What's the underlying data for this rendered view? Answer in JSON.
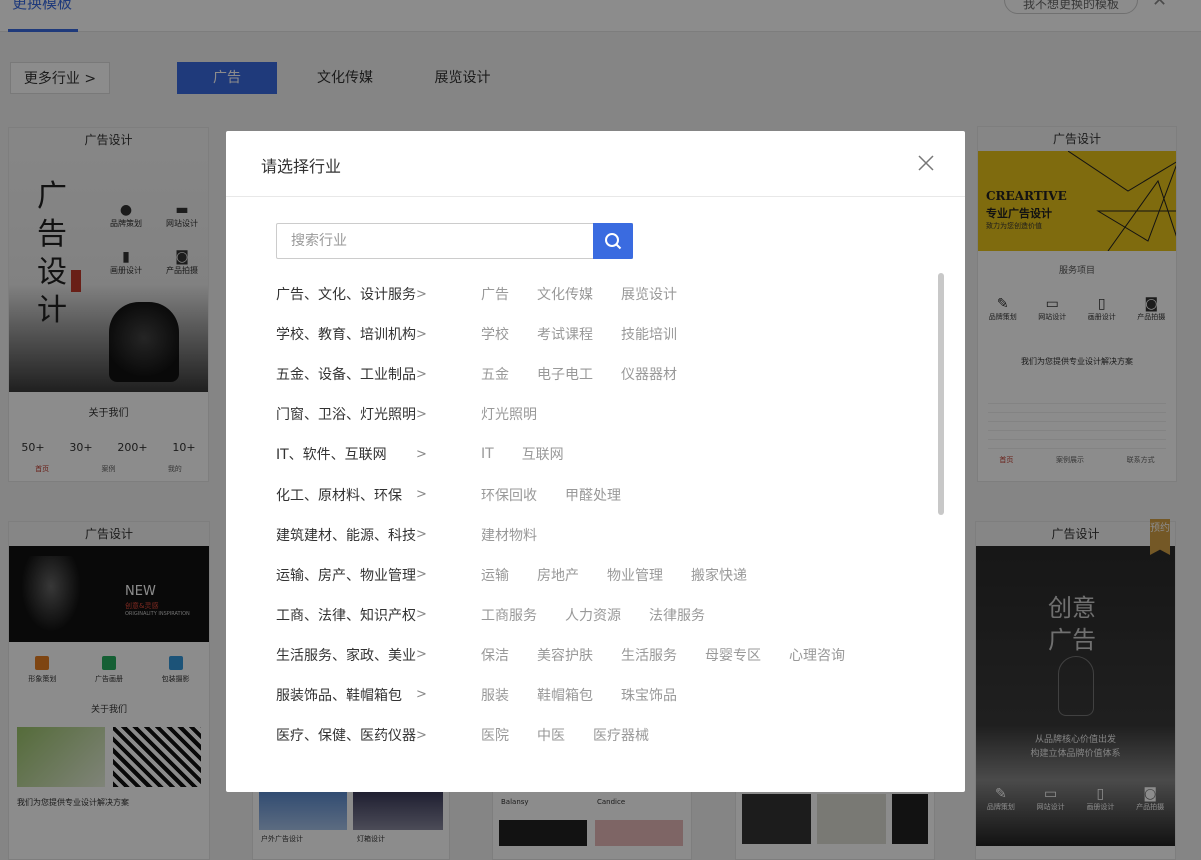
{
  "top": {
    "title": "更换模板",
    "right_button": "我不想更换的模板"
  },
  "filters": {
    "more_label": "更多行业 >",
    "tabs": [
      "广告",
      "文化传媒",
      "展览设计"
    ]
  },
  "cards": [
    {
      "header": "广告设计",
      "headline": "广告设计",
      "icons": [
        "品牌策划",
        "网站设计",
        "画册设计",
        "产品拍摄"
      ],
      "about": "关于我们",
      "stats": [
        "50+",
        "30+",
        "200+",
        "10+"
      ],
      "nav": [
        "首页",
        "案例",
        "我的"
      ]
    },
    {
      "header": "广告设计",
      "creative": "CREARTIVE",
      "creative_sub": "专业广告设计",
      "creative_line": "致力为您创造价值",
      "service": "服务项目",
      "icons": [
        "品牌策划",
        "网站设计",
        "画册设计",
        "产品拍摄"
      ],
      "slogan": "我们为您提供专业设计解决方案",
      "nav": [
        "首页",
        "案例展示",
        "联系方式"
      ]
    },
    {
      "header": "广告设计",
      "banner": "NEW",
      "banner_sub": "创意&灵感",
      "banner_line": "ORIGINALITY INSPIRATION",
      "icons": [
        "形象策划",
        "广告画册",
        "包装摄影"
      ],
      "about": "关于我们",
      "slogan": "我们为您提供专业设计解决方案"
    },
    {
      "header": "广告设计",
      "ribbon": "预约",
      "big_title": "创意广告",
      "line1": "从品牌核心价值出发",
      "line2": "构建立体品牌价值体系",
      "icons": [
        "品牌策划",
        "网站设计",
        "画册设计",
        "产品拍摄"
      ]
    }
  ],
  "bottom_labels": [
    "户外广告设计",
    "灯箱设计",
    "Balansy",
    "Candice"
  ],
  "modal": {
    "title": "请选择行业",
    "search_placeholder": "搜索行业",
    "categories": [
      {
        "name": "广告、文化、设计服务",
        "subs": [
          "广告",
          "文化传媒",
          "展览设计"
        ]
      },
      {
        "name": "学校、教育、培训机构",
        "subs": [
          "学校",
          "考试课程",
          "技能培训"
        ]
      },
      {
        "name": "五金、设备、工业制品",
        "subs": [
          "五金",
          "电子电工",
          "仪器器材"
        ]
      },
      {
        "name": "门窗、卫浴、灯光照明",
        "subs": [
          "灯光照明"
        ]
      },
      {
        "name": "IT、软件、互联网",
        "subs": [
          "IT",
          "互联网"
        ]
      },
      {
        "name": "化工、原材料、环保",
        "subs": [
          "环保回收",
          "甲醛处理"
        ]
      },
      {
        "name": "建筑建材、能源、科技",
        "subs": [
          "建材物料"
        ]
      },
      {
        "name": "运输、房产、物业管理",
        "subs": [
          "运输",
          "房地产",
          "物业管理",
          "搬家快递"
        ]
      },
      {
        "name": "工商、法律、知识产权",
        "subs": [
          "工商服务",
          "人力资源",
          "法律服务"
        ]
      },
      {
        "name": "生活服务、家政、美业",
        "subs": [
          "保洁",
          "美容护肤",
          "生活服务",
          "母婴专区",
          "心理咨询"
        ]
      },
      {
        "name": "服装饰品、鞋帽箱包",
        "subs": [
          "服装",
          "鞋帽箱包",
          "珠宝饰品"
        ]
      },
      {
        "name": "医疗、保健、医药仪器",
        "subs": [
          "医院",
          "中医",
          "医疗器械"
        ]
      }
    ]
  },
  "colors": {
    "accent": "#3a6be0",
    "overlay": "rgba(0,0,0,0.45)",
    "creative_yellow": "#e8c31a"
  }
}
